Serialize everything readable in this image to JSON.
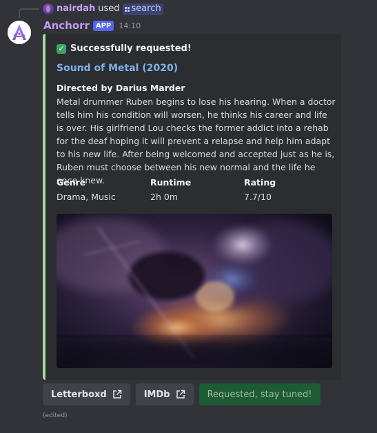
{
  "command": {
    "user": "nairdah",
    "used_text": "used",
    "command_name": "search"
  },
  "author": {
    "name": "Anchorr",
    "tag": "APP",
    "timestamp": "14:10"
  },
  "embed": {
    "accent_color": "#a2d99e",
    "status": "Successfully requested!",
    "title": "Sound of Metal (2020)",
    "director": "Directed by Darius Marder",
    "description": "Metal drummer Ruben begins to lose his hearing. When a doctor tells him his condition will worsen, he thinks his career and life is over. His girlfriend Lou checks the former addict into a rehab for the deaf hoping it will prevent a relapse and help him adapt to his new life. After being welcomed and accepted just as he is, Ruben must choose between his new normal and the life he once knew.",
    "fields": [
      {
        "name": "Genre",
        "value": "Drama, Music"
      },
      {
        "name": "Runtime",
        "value": "2h 0m"
      },
      {
        "name": "Rating",
        "value": "7.7/10"
      }
    ]
  },
  "buttons": [
    {
      "label": "Letterboxd",
      "icon": "external-link-icon"
    },
    {
      "label": "IMDb",
      "icon": "external-link-icon"
    },
    {
      "label": "Requested, stay tuned!"
    }
  ],
  "edited_label": "(edited)",
  "colors": {
    "background": "#313338",
    "embed_background": "#2b2d31",
    "title_link": "#7fb3e8",
    "author_name": "#c29bf2",
    "app_tag": "#5865f2",
    "success_button": "#1c5b34"
  }
}
